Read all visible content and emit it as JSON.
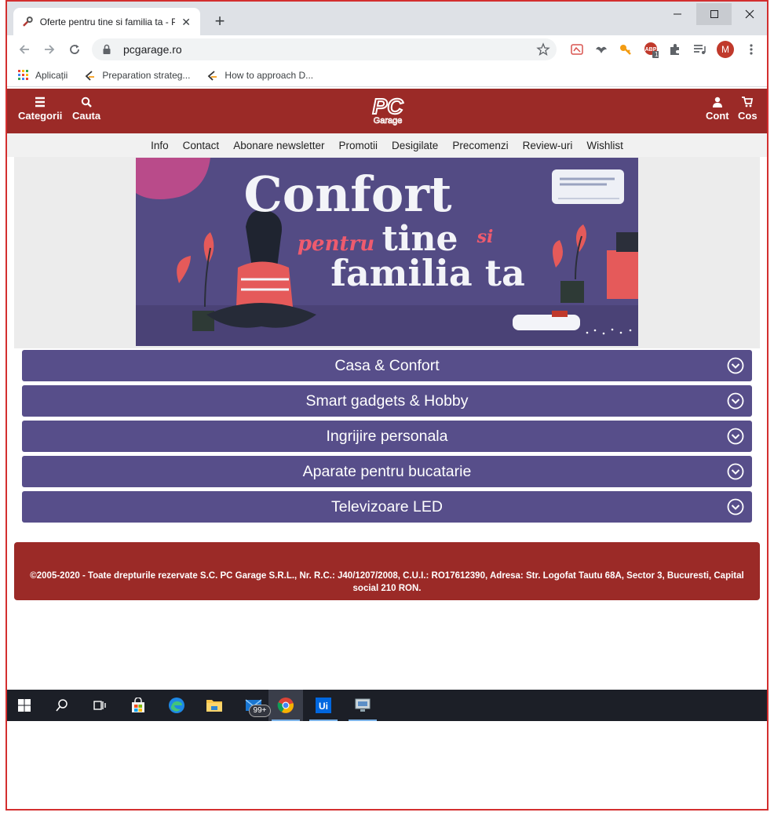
{
  "browser": {
    "tab_title": "Oferte pentru tine si familia ta - P",
    "url": "pcgarage.ro",
    "new_tab": "+",
    "profile_initial": "M",
    "extension_badge": "1",
    "bookmarks": [
      {
        "label": "Aplicații"
      },
      {
        "label": "Preparation strateg..."
      },
      {
        "label": "How to approach D..."
      }
    ]
  },
  "header": {
    "categories_label": "Categorii",
    "search_label": "Cauta",
    "account_label": "Cont",
    "cart_label": "Cos",
    "logo_main": "PC",
    "logo_sub": "Garage"
  },
  "nav": {
    "items": [
      "Info",
      "Contact",
      "Abonare newsletter",
      "Promotii",
      "Desigilate",
      "Precomenzi",
      "Review-uri",
      "Wishlist"
    ]
  },
  "banner": {
    "line1": "Confort",
    "line2a": "pentru",
    "line2b": "tine",
    "line2c": "si",
    "line3": "familia ta"
  },
  "accordion": {
    "items": [
      "Casa & Confort",
      "Smart gadgets & Hobby",
      "Ingrijire personala",
      "Aparate pentru bucatarie",
      "Televizoare LED"
    ]
  },
  "footer": {
    "text": "©2005-2020 - Toate drepturile rezervate S.C. PC Garage S.R.L., Nr. R.C.: J40/1207/2008, C.U.I.: RO17612390, Adresa: Str. Logofat Tautu 68A, Sector 3, Bucuresti, Capital social 210 RON."
  },
  "taskbar": {
    "mail_badge": "99+"
  },
  "colors": {
    "brand_red": "#9b2a27",
    "accordion_purple": "#574e8a",
    "banner_purple": "#534b84"
  }
}
